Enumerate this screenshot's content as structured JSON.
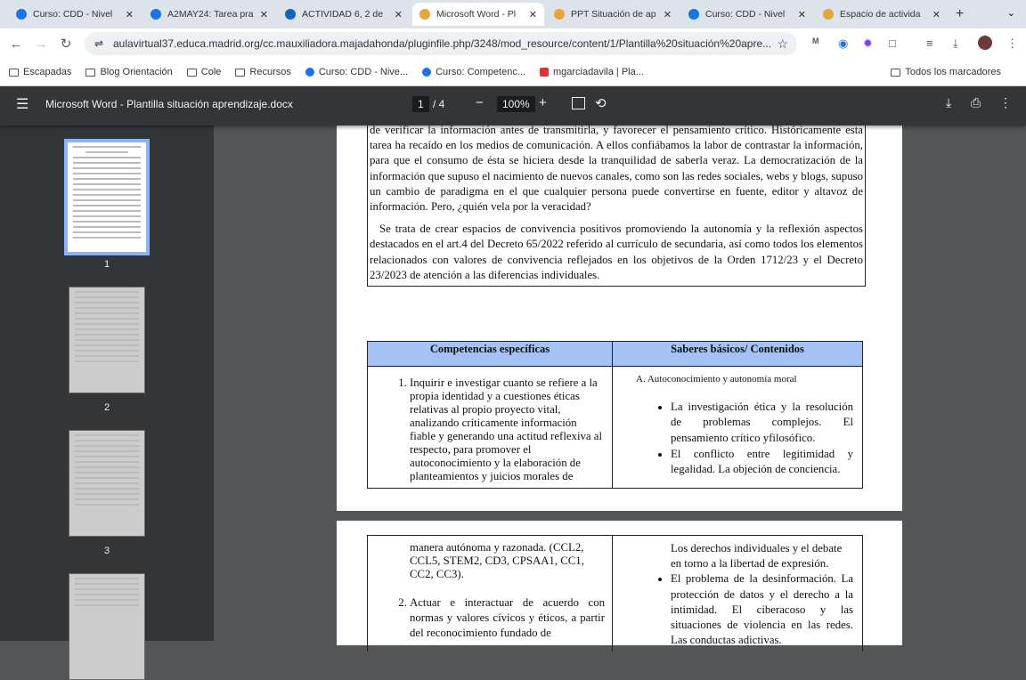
{
  "browser": {
    "tabs": [
      {
        "label": "Curso: CDD - Nivel",
        "color": "#1a73e8"
      },
      {
        "label": "A2MAY24: Tarea pra",
        "color": "#1a73e8"
      },
      {
        "label": "ACTIVIDAD 6, 2 de",
        "color": "#1565c0"
      },
      {
        "label": "Microsoft Word - Pl",
        "color": "#e8a33d",
        "active": true
      },
      {
        "label": "PPT Situación de ap",
        "color": "#e8a33d"
      },
      {
        "label": "Curso: CDD - Nivel",
        "color": "#1a73e8"
      },
      {
        "label": "Espacio de activida",
        "color": "#e8a33d"
      }
    ],
    "url": "aulavirtual37.educa.madrid.org/cc.mauxiliadora.majadahonda/pluginfile.php/3248/mod_resource/content/1/Plantilla%20situación%20apre...",
    "bookmarks": [
      "Escapadas",
      "Blog Orientación",
      "Cole",
      "Recursos",
      "Curso: CDD - Nive...",
      "Curso: Competenc...",
      "mgarciadavila | Pla..."
    ],
    "all_bookmarks": "Todos los marcadores"
  },
  "viewer": {
    "title": "Microsoft Word - Plantilla situación aprendizaje.docx",
    "page": "1",
    "total": "/ 4",
    "zoom": "100%",
    "thumb_labels": [
      "1",
      "2",
      "3"
    ]
  },
  "doc": {
    "para1": "de verificar la información antes de transmitirla, y favorecer el pensamiento crítico. Históricamente esta tarea ha recaído en los medios de comunicación. A ellos confiábamos la labor de contrastar la información, para que el consumo de ésta se hiciera desde la tranquilidad de saberla veraz. La democratización de la información que supuso el nacimiento de nuevos canales, como son las redes sociales, webs y blogs, supuso un cambio de paradigma en el que cualquier persona puede convertirse en fuente, editor y altavoz de información. Pero, ¿quién vela por la veracidad?",
    "para2": "Se trata de crear espacios de convivencia positivos promoviendo la autonomía y la reflexión aspectos destacados en el art.4 del Decreto 65/2022 referido al currículo de secundaria, así como todos los elementos relacionados con valores de convivencia reflejados en los objetivos de la Orden 1712/23 y el Decreto 23/2023 de atención a las diferencias individuales.",
    "col1": "Competencias específicas",
    "col2": "Saberes básicos/ Contenidos",
    "comp1": "Inquirir e investigar cuanto se refiere a la propia identidad y a cuestiones éticas relativas al propio proyecto vital, analizando críticamente información fiable y generando una actitud reflexiva al respecto, para promover el autoconocimiento y la elaboración de planteamientos y juicios morales de",
    "saberA": "A. Autoconocimiento y autonomía moral",
    "saber1": "La investigación ética y la resolución de problemas complejos. El pensamiento crítico yfilosófico.",
    "saber2": "El conflicto entre legitimidad y legalidad. La objeción de conciencia.",
    "comp1_cont": "manera autónoma y razonada. (CCL2, CCL5, STEM2, CD3, CPSAA1, CC1, CC2, CC3).",
    "comp2": "Actuar e interactuar de acuerdo con normas y valores cívicos y éticos, a partir del reconocimiento fundado de",
    "saber3": "Los derechos individuales y el debate en torno a la libertad de expresión.",
    "saber4": "El problema de la desinformación. La protección de datos y el derecho a la intimidad. El ciberacoso y las situaciones de violencia en las redes. Las conductas adictivas."
  }
}
